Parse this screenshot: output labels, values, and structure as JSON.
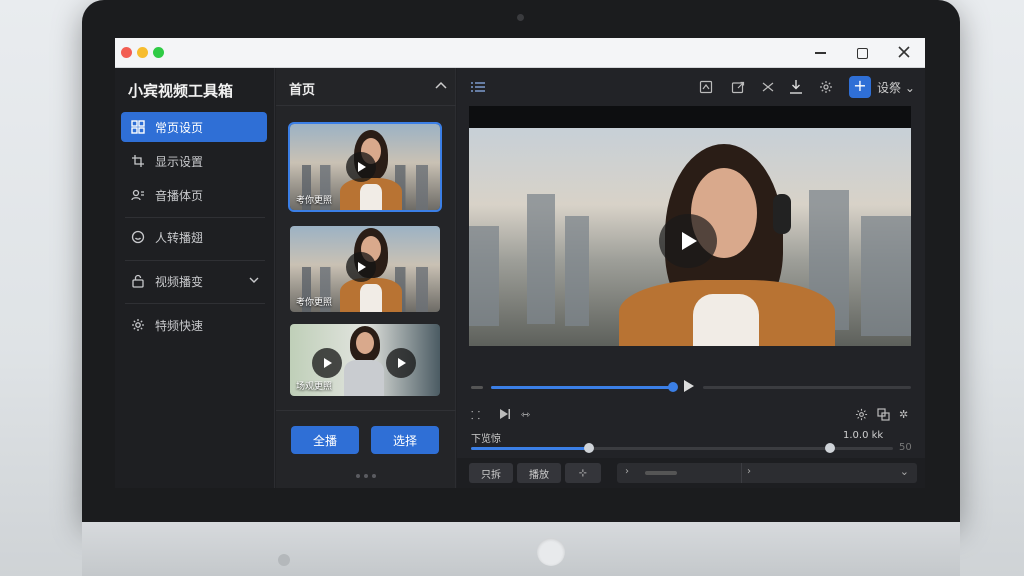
{
  "sidebar": {
    "app_title": "小宾视频工具箱",
    "items": [
      {
        "label": "常页设页",
        "icon": "grid-icon",
        "active": true
      },
      {
        "label": "显示设置",
        "icon": "crop-icon"
      },
      {
        "label": "音播体页",
        "icon": "user-card-icon"
      },
      {
        "label": "人转播翅",
        "icon": "smile-icon"
      },
      {
        "label": "视频播变",
        "icon": "lock-icon"
      },
      {
        "label": "特频快速",
        "icon": "gear-icon"
      }
    ]
  },
  "thumbs": {
    "title": "首页",
    "items": [
      {
        "caption": "考你更照"
      },
      {
        "caption": "考你更照"
      },
      {
        "caption": "场观更照"
      }
    ],
    "primary_button": "全播",
    "secondary_button": "选择"
  },
  "player": {
    "volume_label": "下览惊",
    "time_display": "1.0.0 kk",
    "end_value": "50",
    "progress": 0.48,
    "volume_progress": 0.28,
    "right_progress": 0.85
  },
  "toolbar": {
    "settings_label": "设祭"
  },
  "bottom": {
    "chip1": "只拆",
    "chip2": "播放"
  },
  "colors": {
    "accent": "#2f6fd6",
    "titlebar": "#f4f5f7",
    "sidebar_bg": "#1e1f22"
  }
}
